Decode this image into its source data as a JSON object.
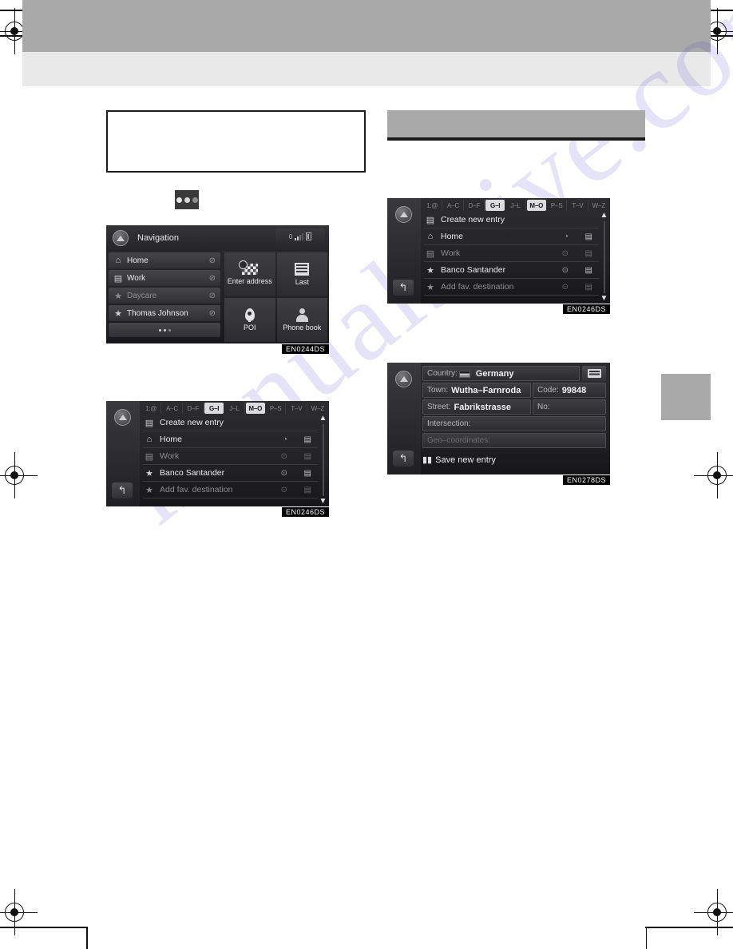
{
  "page": {
    "watermark_text": "manualshive.com"
  },
  "callout": {
    "note_text": ""
  },
  "dots_button": {
    "name": "more-dots-button"
  },
  "screens": {
    "navigation": {
      "code": "EN0244DS",
      "title": "Navigation",
      "status": {
        "clock": "0",
        "signal": "signal-bars",
        "battery": "battery"
      },
      "list": [
        {
          "icon": "home-icon",
          "glyph": "⌂",
          "label": "Home",
          "chevron": "⊘",
          "dim": false
        },
        {
          "icon": "work-icon",
          "glyph": "▤",
          "label": "Work",
          "chevron": "⊘",
          "dim": false
        },
        {
          "icon": "star-icon",
          "glyph": "★",
          "label": "Daycare",
          "chevron": "⊘",
          "dim": true
        },
        {
          "icon": "star-icon",
          "glyph": "★",
          "label": "Thomas Johnson",
          "chevron": "⊘",
          "dim": false
        }
      ],
      "more_label": "•••",
      "tiles": [
        {
          "icon": "checkered-flag-icon",
          "label": "Enter address"
        },
        {
          "icon": "list-icon",
          "label": "Last"
        },
        {
          "icon": "map-pin-icon",
          "label": "POI"
        },
        {
          "icon": "person-icon",
          "label": "Phone book"
        }
      ]
    },
    "favourites_left": {
      "code": "EN0246DS",
      "tabs": [
        {
          "label": "1:@",
          "active": false
        },
        {
          "label": "A–C",
          "active": false
        },
        {
          "label": "D–F",
          "active": false
        },
        {
          "label": "G–I",
          "active": true
        },
        {
          "label": "J–L",
          "active": false
        },
        {
          "label": "M–O",
          "active": true
        },
        {
          "label": "P–S",
          "active": false
        },
        {
          "label": "T–V",
          "active": false
        },
        {
          "label": "W–Z",
          "active": false
        }
      ],
      "rows": [
        {
          "glyph": "▤",
          "label": "Create new entry",
          "action1": "",
          "action2": "",
          "dim": false,
          "header": true
        },
        {
          "glyph": "⌂",
          "label": "Home",
          "action1": "◔",
          "action2": "▤",
          "dim": false,
          "header": false
        },
        {
          "glyph": "▤",
          "label": "Work",
          "action1": "⊙",
          "action2": "▤",
          "dim": true,
          "header": false
        },
        {
          "glyph": "★",
          "label": "Banco Santander",
          "action1": "⊙",
          "action2": "▤",
          "dim": false,
          "header": false
        },
        {
          "glyph": "★",
          "label": "Add fav. destination",
          "action1": "⊙",
          "action2": "▤",
          "dim": true,
          "header": false
        }
      ],
      "scroll": {
        "up": "▲",
        "down": "▼"
      },
      "back_glyph": "↰"
    },
    "favourites_right": {
      "code": "EN0246DS",
      "tabs": [
        {
          "label": "1:@",
          "active": false
        },
        {
          "label": "A–C",
          "active": false
        },
        {
          "label": "D–F",
          "active": false
        },
        {
          "label": "G–I",
          "active": true
        },
        {
          "label": "J–L",
          "active": false
        },
        {
          "label": "M–O",
          "active": true
        },
        {
          "label": "P–S",
          "active": false
        },
        {
          "label": "T–V",
          "active": false
        },
        {
          "label": "W–Z",
          "active": false
        }
      ],
      "rows": [
        {
          "glyph": "▤",
          "label": "Create new entry",
          "action1": "",
          "action2": "",
          "dim": false,
          "header": true
        },
        {
          "glyph": "⌂",
          "label": "Home",
          "action1": "◔",
          "action2": "▤",
          "dim": false,
          "header": false
        },
        {
          "glyph": "▤",
          "label": "Work",
          "action1": "⊙",
          "action2": "▤",
          "dim": true,
          "header": false
        },
        {
          "glyph": "★",
          "label": "Banco Santander",
          "action1": "⊙",
          "action2": "▤",
          "dim": false,
          "header": false
        },
        {
          "glyph": "★",
          "label": "Add fav. destination",
          "action1": "⊙",
          "action2": "▤",
          "dim": true,
          "header": false
        }
      ],
      "scroll": {
        "up": "▲",
        "down": "▼"
      },
      "back_glyph": "↰"
    },
    "address_entry": {
      "code": "EN0278DS",
      "fields": {
        "country_key": "Country:",
        "country_value": "Germany",
        "town_key": "Town:",
        "town_value": "Wutha–Farnroda",
        "code_key": "Code:",
        "code_value": "99848",
        "street_key": "Street:",
        "street_value": "Fabrikstrasse",
        "no_key": "No:",
        "no_value": "",
        "intersection_key": "Intersection:",
        "intersection_value": "",
        "geo_key": "Geo–coordinates:",
        "geo_value": ""
      },
      "keyboard_button": "keyboard-icon",
      "save_label": "Save new entry",
      "save_icon": "save-icon",
      "back_glyph": "↰"
    }
  },
  "colors": {
    "header_band": "#a9a9a9",
    "header_sub": "#e9e9e9",
    "screen_dark": "#1d1d1f",
    "accent_light": "#dcdcde",
    "watermark": "#3c33c8"
  }
}
